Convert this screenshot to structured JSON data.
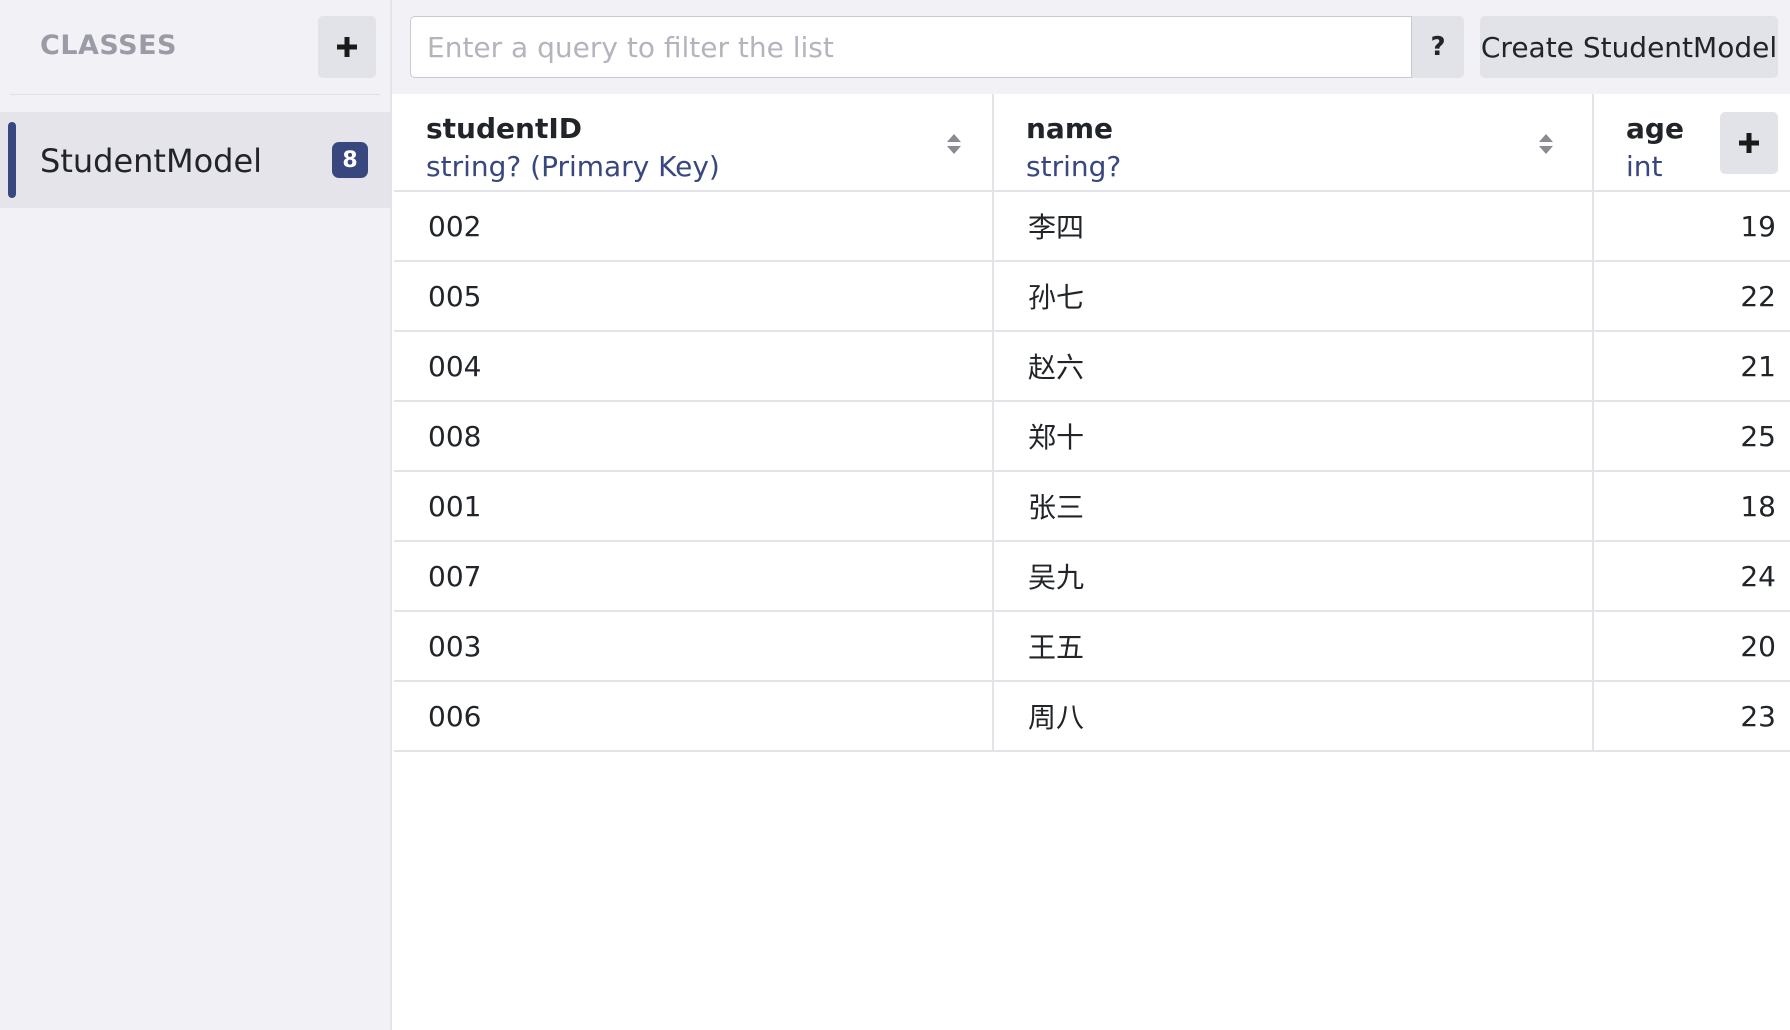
{
  "sidebar": {
    "title": "CLASSES",
    "add_label": "+",
    "items": [
      {
        "label": "StudentModel",
        "count": "8"
      }
    ]
  },
  "toolbar": {
    "search_placeholder": "Enter a query to filter the list",
    "help_label": "?",
    "create_label": "Create StudentModel"
  },
  "table": {
    "columns": [
      {
        "name": "studentID",
        "type": "string? (Primary Key)"
      },
      {
        "name": "name",
        "type": "string?"
      },
      {
        "name": "age",
        "type": "int"
      }
    ],
    "add_column_label": "+",
    "rows": [
      {
        "studentID": "002",
        "name": "李四",
        "age": "19"
      },
      {
        "studentID": "005",
        "name": "孙七",
        "age": "22"
      },
      {
        "studentID": "004",
        "name": "赵六",
        "age": "21"
      },
      {
        "studentID": "008",
        "name": "郑十",
        "age": "25"
      },
      {
        "studentID": "001",
        "name": "张三",
        "age": "18"
      },
      {
        "studentID": "007",
        "name": "吴九",
        "age": "24"
      },
      {
        "studentID": "003",
        "name": "王五",
        "age": "20"
      },
      {
        "studentID": "006",
        "name": "周八",
        "age": "23"
      }
    ]
  },
  "colors": {
    "accent": "#39477f",
    "sidebar_bg": "#f2f1f6",
    "button_bg": "#e2e2e9"
  }
}
